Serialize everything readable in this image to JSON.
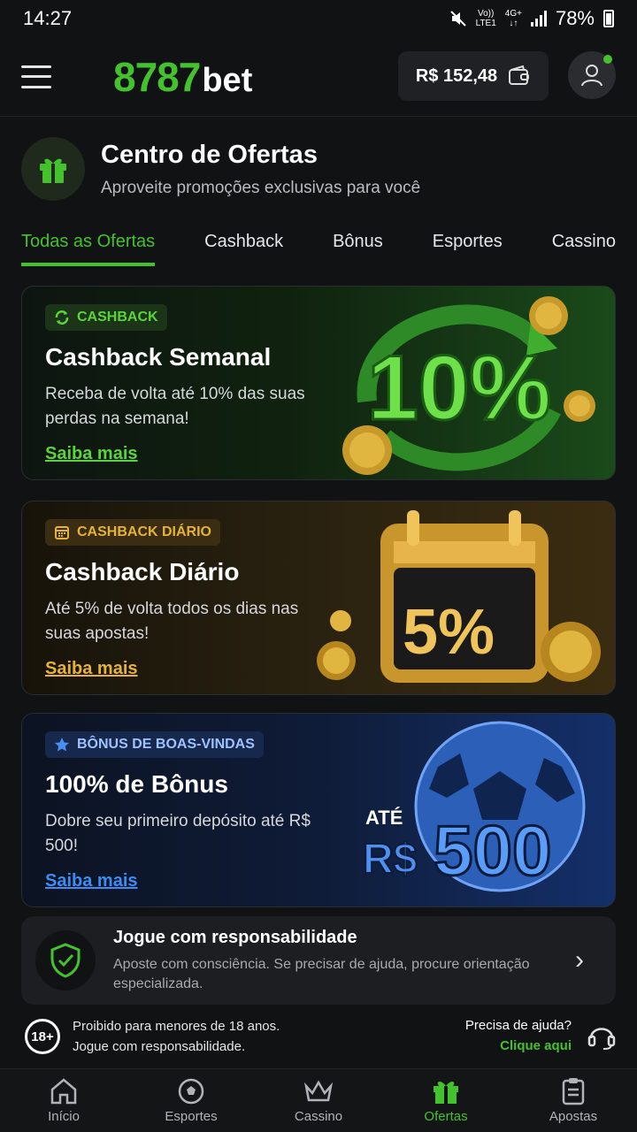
{
  "status_bar": {
    "time": "14:27",
    "network_top": "Vo))",
    "network_bottom": "LTE1",
    "net_gen": "4G+",
    "battery": "78%"
  },
  "header": {
    "logo_number": "8787",
    "logo_text": "bet",
    "balance": "R$ 152,48"
  },
  "offers_center": {
    "title": "Centro de Ofertas",
    "subtitle": "Aproveite promoções exclusivas para você"
  },
  "tabs": [
    {
      "label": "Todas as Ofertas",
      "active": true
    },
    {
      "label": "Cashback",
      "active": false
    },
    {
      "label": "Bônus",
      "active": false
    },
    {
      "label": "Esportes",
      "active": false
    },
    {
      "label": "Cassino",
      "active": false
    }
  ],
  "cards": [
    {
      "badge": "CASHBACK",
      "title": "Cashback Semanal",
      "description": "Receba de volta até 10% das suas perdas na semana!",
      "link": "Saiba mais",
      "art_text": "10%"
    },
    {
      "badge": "CASHBACK DIÁRIO",
      "title": "Cashback Diário",
      "description": "Até 5% de volta todos os dias nas suas apostas!",
      "link": "Saiba mais",
      "art_text": "5%"
    },
    {
      "badge": "BÔNUS DE BOAS-VINDAS",
      "title": "100% de Bônus",
      "description": "Dobre seu primeiro depósito até R$ 500!",
      "link": "Saiba mais",
      "art_top": "ATÉ",
      "art_currency": "R$",
      "art_amount": "500"
    }
  ],
  "responsibility": {
    "title": "Jogue com responsabilidade",
    "subtitle": "Aposte com consciência. Se precisar de ajuda, procure orientação especializada."
  },
  "notice": {
    "age": "18+",
    "line1": "Proibido para menores de 18 anos.",
    "line2": "Jogue com responsabilidade.",
    "help_question": "Precisa de ajuda?",
    "help_link": "Clique aqui"
  },
  "bottom_nav": [
    {
      "label": "Início",
      "icon": "home-icon",
      "active": false
    },
    {
      "label": "Esportes",
      "icon": "soccer-ball-icon",
      "active": false
    },
    {
      "label": "Cassino",
      "icon": "crown-icon",
      "active": false
    },
    {
      "label": "Ofertas",
      "icon": "gift-icon",
      "active": true
    },
    {
      "label": "Apostas",
      "icon": "bet-slip-icon",
      "active": false
    }
  ],
  "colors": {
    "accent": "#44c22d",
    "gold": "#e5b23a",
    "blue": "#3b8df5",
    "background": "#111214"
  }
}
